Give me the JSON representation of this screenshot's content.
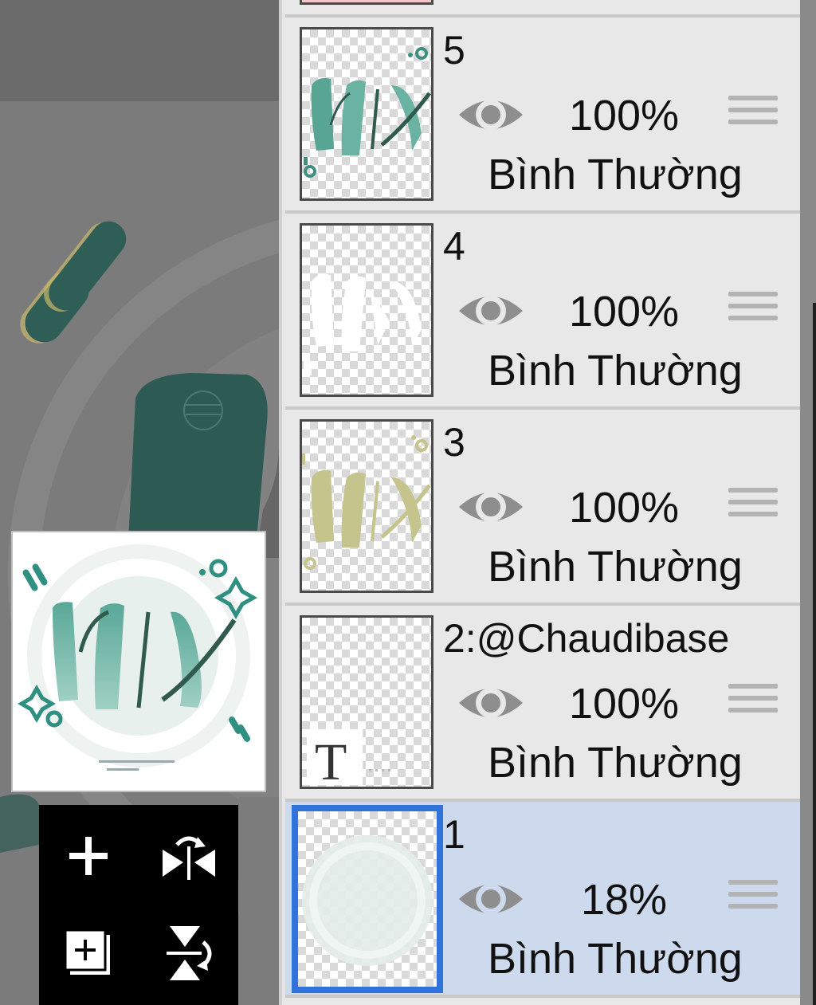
{
  "tools": [
    {
      "name": "add-layer",
      "icon": "plus-icon"
    },
    {
      "name": "flip-horizontal",
      "icon": "flip-horizontal-icon"
    },
    {
      "name": "duplicate-layer",
      "icon": "add-copy-icon"
    },
    {
      "name": "flip-vertical",
      "icon": "flip-vertical-icon"
    }
  ],
  "layers": [
    {
      "name": "5",
      "opacity": "100%",
      "blend_mode": "Bình Thường",
      "visible": true,
      "selected": false
    },
    {
      "name": "4",
      "opacity": "100%",
      "blend_mode": "Bình Thường",
      "visible": true,
      "selected": false
    },
    {
      "name": "3",
      "opacity": "100%",
      "blend_mode": "Bình Thường",
      "visible": true,
      "selected": false
    },
    {
      "name": "2:@Chaudibase",
      "opacity": "100%",
      "blend_mode": "Bình Thường",
      "visible": true,
      "selected": false,
      "type_icon": "text-layer-icon"
    },
    {
      "name": "1",
      "opacity": "18%",
      "blend_mode": "Bình Thường",
      "visible": true,
      "selected": true
    }
  ],
  "preview": {
    "artwork_text": "NIX"
  },
  "colors": {
    "accent_selected_border": "#2f73db",
    "selected_row_bg": "#cdd9ec",
    "art_teal": "#3f8f80",
    "art_olive": "#c4c48c"
  }
}
